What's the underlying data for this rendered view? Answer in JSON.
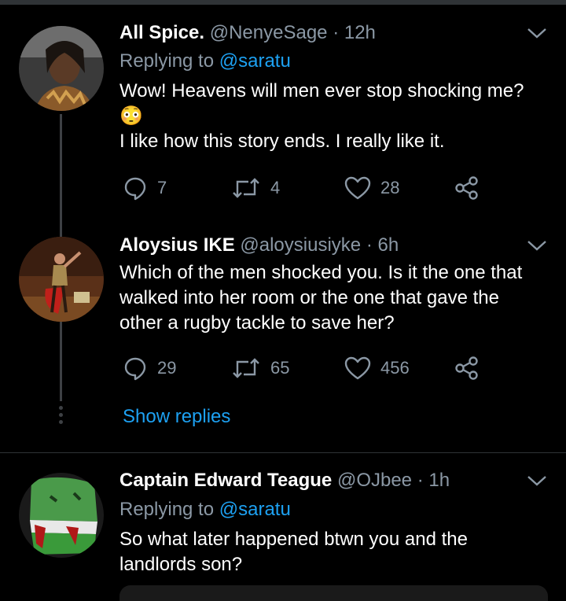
{
  "tweets": [
    {
      "name": "All Spice.",
      "handle": "@NenyeSage",
      "dot": "·",
      "time": "12h",
      "replying_prefix": "Replying to",
      "replying_to": "@saratu",
      "lines": [
        "Wow! Heavens will men ever stop shocking me?",
        "😳",
        "I like how this story ends. I really like it."
      ],
      "replies": "7",
      "retweets": "4",
      "likes": "28"
    },
    {
      "name": "Aloysius IKE",
      "handle": "@aloysiusiyke",
      "dot": "·",
      "time": "6h",
      "lines": [
        "Which of the men shocked you. Is it the one that",
        "walked into her room or the one that gave the",
        "other a rugby tackle to save her?"
      ],
      "replies": "29",
      "retweets": "65",
      "likes": "456"
    },
    {
      "name": "Captain Edward Teague",
      "handle": "@OJbee",
      "dot": "·",
      "time": "1h",
      "replying_prefix": "Replying to",
      "replying_to": "@saratu",
      "lines": [
        "So what later happened btwn you and the",
        "landlords son?"
      ]
    }
  ],
  "show_replies": "Show replies",
  "icons": {
    "reply": "reply-icon",
    "retweet": "retweet-icon",
    "like": "heart-icon",
    "share": "share-icon",
    "menu": "chevron-down-icon"
  },
  "colors": {
    "background": "#000000",
    "accent": "#1da1f2",
    "secondary_text": "#8b98a5"
  }
}
